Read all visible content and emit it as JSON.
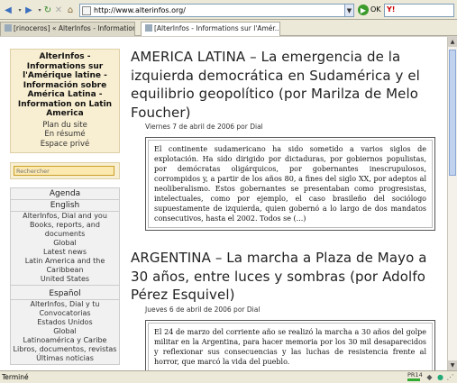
{
  "browser": {
    "url": "http://www.alterinfos.org/",
    "go_label": "OK",
    "search_engine_logo": "Y!",
    "tabs": [
      {
        "label": "[rinoceros] « AlterInfos - Informations sur l'A..."
      },
      {
        "label": "[AlterInfos - Informations sur l'Amér..."
      }
    ],
    "status": "Terminé",
    "pr_label": "PR14"
  },
  "sidebar": {
    "site_title": "AlterInfos - Informations sur l'Amérique latine - Información sobre América Latina - Information on Latin America",
    "links": [
      "Plan du site",
      "En résumé",
      "Espace privé"
    ],
    "search_placeholder": "Rechercher",
    "nav": {
      "agenda": "Agenda",
      "english": {
        "heading": "English",
        "items": [
          "AlterInfos, Dial and you",
          "Books, reports, and documents",
          "Global",
          "Latest news",
          "Latin America and the Caribbean",
          "United States"
        ]
      },
      "espanol": {
        "heading": "Español",
        "items": [
          "AlterInfos, Dial y tu",
          "Convocatorias",
          "Estados Unidos",
          "Global",
          "Latinoamérica y Caribe",
          "Libros, documentos, revistas",
          "Últimas noticias"
        ]
      }
    }
  },
  "articles": [
    {
      "title": "AMERICA LATINA – La emergencia de la izquierda democrática en Sudamérica y el equilibrio geopolítico (por Marilza de Melo Foucher)",
      "date": "Viernes 7 de abril de 2006 por Dial",
      "summary": "El continente sudamericano ha sido sometido a varios siglos de explotación. Ha sido dirigido por dictaduras, por gobiernos populistas, por demócratas oligárquicos, por gobernantes inescrupulosos, corrompidos y, a partir de los años 80, a fines del siglo XX, por adeptos al neoliberalismo. Estos gobernantes se presentaban como progresistas, intelectuales, como por ejemplo, el caso brasileño del sociólogo supuestamente de izquierda, quien gobernó a lo largo de dos mandatos consecutivos, hasta el 2002. Todos se (...)"
    },
    {
      "title": "ARGENTINA – La marcha a Plaza de Mayo a 30 años, entre luces y sombras (por Adolfo Pérez Esquivel)",
      "date": "Jueves 6 de abril de 2006 por Dial",
      "summary": "El 24 de marzo del corriente año se realizó la marcha a 30 años del golpe militar en la Argentina, para hacer memoria por los 30 mil desaparecidos y reflexionar sus consecuencias y las luchas de resistencia frente al horror, que marcó la vida del pueblo."
    }
  ]
}
